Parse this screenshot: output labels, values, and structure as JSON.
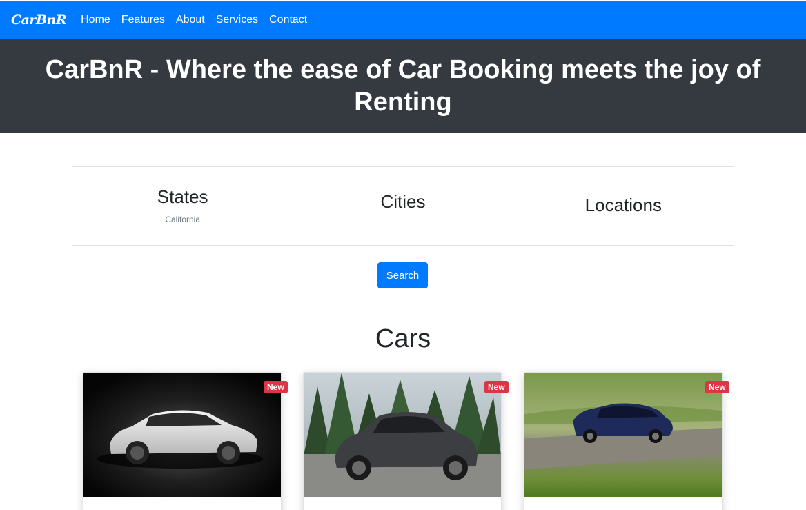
{
  "navbar": {
    "brand": "CarBnR",
    "links": [
      "Home",
      "Features",
      "About",
      "Services",
      "Contact"
    ]
  },
  "hero": {
    "title": "CarBnR - Where the ease of Car Booking meets the joy of Renting"
  },
  "filters": {
    "states": {
      "label": "States",
      "value": "California"
    },
    "cities": {
      "label": "Cities"
    },
    "locations": {
      "label": "Locations"
    }
  },
  "search_button": "Search",
  "cars_section": {
    "title": "Cars",
    "cards": [
      {
        "badge": "New",
        "image": "white-sedan-dark-studio"
      },
      {
        "badge": "New",
        "image": "gray-sedan-forest"
      },
      {
        "badge": "New",
        "image": "blue-sedan-road"
      }
    ]
  },
  "colors": {
    "primary": "#007bff",
    "dark": "#343a40",
    "badge": "#dc3545"
  }
}
